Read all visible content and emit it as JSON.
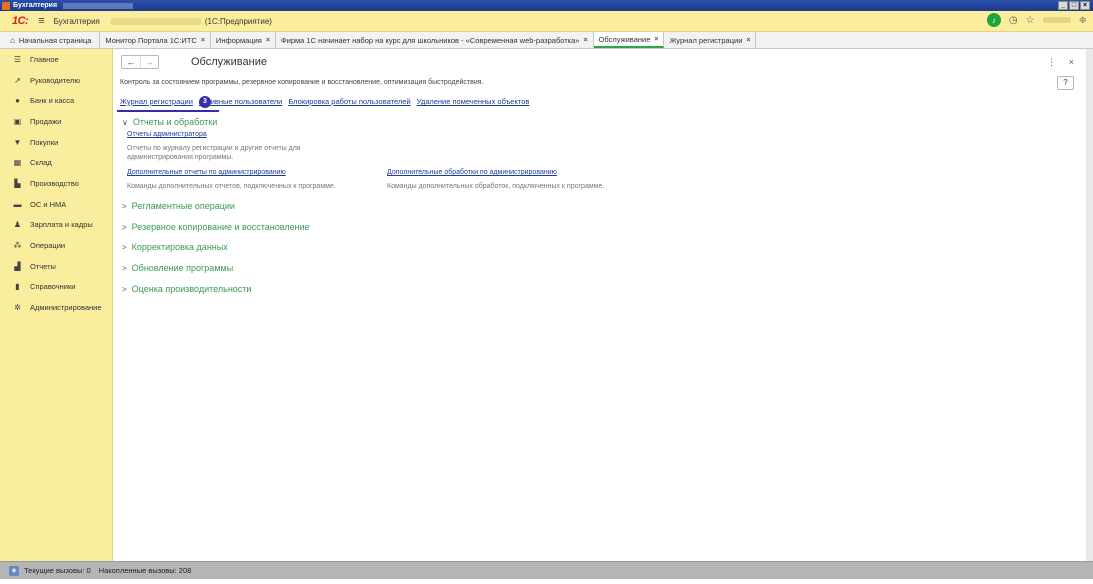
{
  "window": {
    "title": "Бухгалтерия"
  },
  "header": {
    "logo": "1С:",
    "app_name": "Бухгалтерия",
    "platform": "(1С:Предприятие)"
  },
  "tabs": [
    {
      "label": "Начальная страница",
      "closable": false
    },
    {
      "label": "Монитор Портала 1С:ИТС",
      "closable": true
    },
    {
      "label": "Информация",
      "closable": true
    },
    {
      "label": "Фирма 1С начинает набор на курс для школьников - «Современная web-разработка»",
      "closable": true
    },
    {
      "label": "Обслуживание",
      "closable": true,
      "active": true
    },
    {
      "label": "Журнал регистрации",
      "closable": true
    }
  ],
  "sidebar": {
    "items": [
      {
        "label": "Главное",
        "icon": "menu-lines-icon"
      },
      {
        "label": "Руководителю",
        "icon": "trend-icon"
      },
      {
        "label": "Банк и касса",
        "icon": "coin-icon"
      },
      {
        "label": "Продажи",
        "icon": "bag-icon"
      },
      {
        "label": "Покупки",
        "icon": "cart-icon"
      },
      {
        "label": "Склад",
        "icon": "warehouse-icon"
      },
      {
        "label": "Производство",
        "icon": "factory-icon"
      },
      {
        "label": "ОС и НМА",
        "icon": "truck-icon"
      },
      {
        "label": "Зарплата и кадры",
        "icon": "person-icon"
      },
      {
        "label": "Операции",
        "icon": "operations-icon"
      },
      {
        "label": "Отчеты",
        "icon": "bar-chart-icon"
      },
      {
        "label": "Справочники",
        "icon": "book-icon"
      },
      {
        "label": "Администрирование",
        "icon": "gear-icon"
      }
    ]
  },
  "main": {
    "title": "Обслуживание",
    "description": "Контроль за состоянием программы, резервное копирование и восстановление, оптимизация быстродействия.",
    "help_label": "?",
    "top_links": [
      "Журнал регистрации",
      "Активные пользователи",
      "Блокировка работы пользователей",
      "Удаление помеченных объектов"
    ],
    "badge": "3",
    "groups": [
      {
        "title": "Отчеты и обработки",
        "expanded": true,
        "items": [
          {
            "link": "Отчеты администратора",
            "desc": "Отчеты по журналу регистрации и другие отчеты для администрирования программы."
          },
          {
            "link": "Дополнительные отчеты по администрированию",
            "desc": "Команды дополнительных отчетов, подключенных к программе."
          },
          {
            "link": "Дополнительные обработки по администрированию",
            "desc": "Команды дополнительных обработок, подключенных к программе."
          }
        ]
      },
      {
        "title": "Регламентные операции",
        "expanded": false
      },
      {
        "title": "Резервное копирование и восстановление",
        "expanded": false
      },
      {
        "title": "Корректировка данных",
        "expanded": false
      },
      {
        "title": "Обновление программы",
        "expanded": false
      },
      {
        "title": "Оценка производительности",
        "expanded": false
      }
    ]
  },
  "status": {
    "current_calls": "Текущие вызовы: 0",
    "accumulated_calls": "Накопленные вызовы: 208"
  },
  "colors": {
    "sidebar_bg": "#fbed9e",
    "group_title": "#3a9a52",
    "link": "#1d3d99",
    "badge": "#3b2aa8",
    "active_tab_underline": "#2aa64a"
  }
}
